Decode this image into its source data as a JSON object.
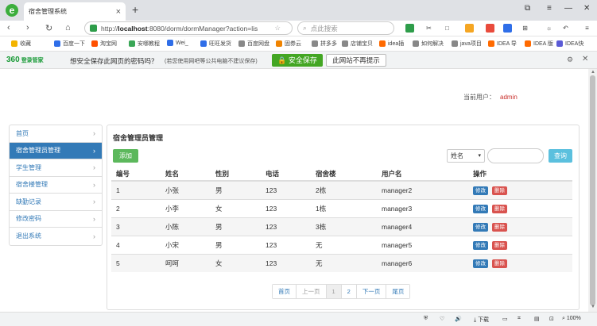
{
  "browser": {
    "tab_title": "宿舍管理系统",
    "tab_close": "×",
    "new_tab": "+",
    "url_prefix": "http://",
    "url_host": "localhost",
    "url_rest": ":8080/dorm/dormManager?action=lis",
    "search_placeholder": "点此搜索",
    "bookmarks": [
      {
        "label": "收藏",
        "color": "#f3b400"
      },
      {
        "label": "百度一下",
        "color": "#2f6ee8"
      },
      {
        "label": "淘宝网",
        "color": "#ff5000"
      },
      {
        "label": "安哪教程",
        "color": "#3aa757"
      },
      {
        "label": "Wei_",
        "color": "#2f6ee8"
      },
      {
        "label": "旺旺发货",
        "color": "#2f6ee8"
      },
      {
        "label": "百度网盘",
        "color": "#888888"
      },
      {
        "label": "固券云",
        "color": "#f08300"
      },
      {
        "label": "拼多多",
        "color": "#888888"
      },
      {
        "label": "店铺宝贝",
        "color": "#888888"
      },
      {
        "label": "idea插",
        "color": "#ff6a00"
      },
      {
        "label": "如何解决",
        "color": "#888888"
      },
      {
        "label": "java项目",
        "color": "#888888"
      },
      {
        "label": "IDEA 导",
        "color": "#ff6a00"
      },
      {
        "label": "IDEA 版",
        "color": "#ff6a00"
      },
      {
        "label": "IDEA快",
        "color": "#5b5bd6"
      }
    ]
  },
  "password_bar": {
    "logo": "360",
    "logo_sub": "登录管家",
    "question": "想安全保存此网页的密码吗？",
    "note": "(若您使用网吧等公共电脑不建议保存)",
    "save_label": "安全保存",
    "never_label": "此网站不再提示"
  },
  "header": {
    "current_user_label": "当前用户：",
    "current_user": "admin"
  },
  "sidebar": {
    "items": [
      {
        "label": "首页",
        "active": false
      },
      {
        "label": "宿舍管理员管理",
        "active": true
      },
      {
        "label": "学生管理",
        "active": false
      },
      {
        "label": "宿舍楼管理",
        "active": false
      },
      {
        "label": "缺勤记录",
        "active": false
      },
      {
        "label": "修改密码",
        "active": false
      },
      {
        "label": "退出系统",
        "active": false
      }
    ]
  },
  "main": {
    "panel_title": "宿舍管理员管理",
    "add_label": "添加",
    "select_value": "姓名",
    "search_label": "查询",
    "columns": [
      "编号",
      "姓名",
      "性别",
      "电话",
      "宿舍楼",
      "用户名",
      "操作"
    ],
    "rows": [
      [
        "1",
        "小张",
        "男",
        "123",
        "2栋",
        "manager2"
      ],
      [
        "2",
        "小李",
        "女",
        "123",
        "1栋",
        "manager3"
      ],
      [
        "3",
        "小陈",
        "男",
        "123",
        "3栋",
        "manager4"
      ],
      [
        "4",
        "小宋",
        "男",
        "123",
        "无",
        "manager5"
      ],
      [
        "5",
        "呵呵",
        "女",
        "123",
        "无",
        "manager6"
      ]
    ],
    "edit_label": "修改",
    "delete_label": "删除",
    "pager": [
      "首页",
      "上一页",
      "1",
      "2",
      "下一页",
      "尾页"
    ]
  },
  "statusbar": {
    "download": "下载",
    "zoom": "100%"
  }
}
